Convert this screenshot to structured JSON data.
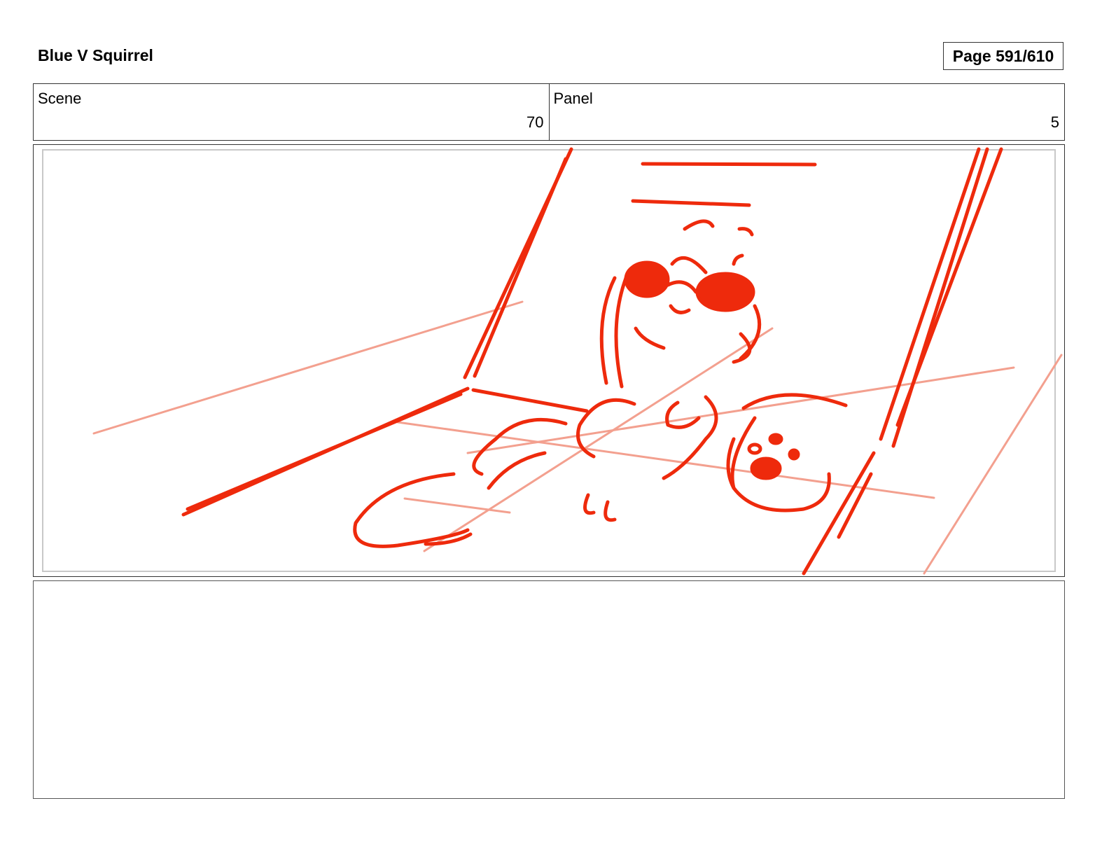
{
  "header": {
    "title": "Blue V Squirrel",
    "page_label": "Page 591/610"
  },
  "info": {
    "scene_label": "Scene",
    "scene_value": "70",
    "panel_label": "Panel",
    "panel_value": "5"
  },
  "sketch": {
    "stroke_color": "#ee2a0c",
    "guide_color": "#f3a08f",
    "description_icon": "storyboard-sketch-icon"
  },
  "notes": {
    "text": ""
  }
}
